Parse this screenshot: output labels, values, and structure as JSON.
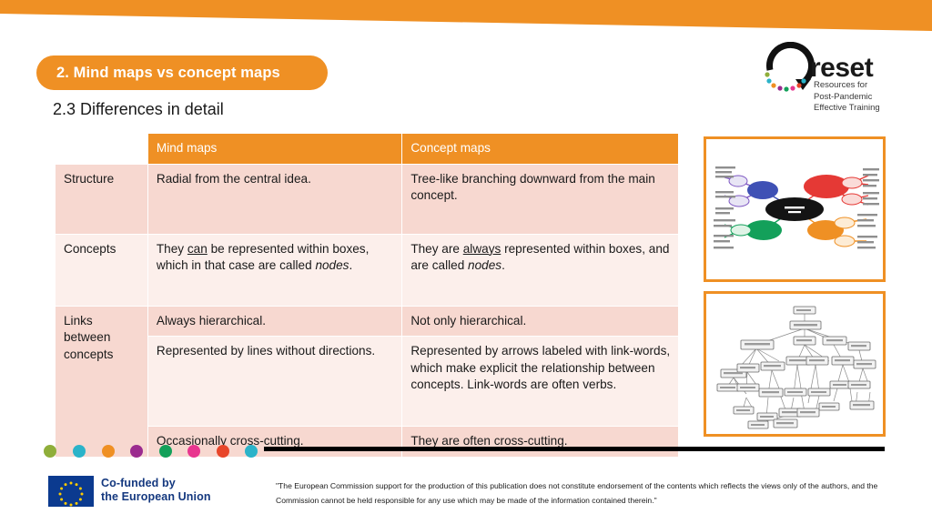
{
  "slide": {
    "section_title": "2. Mind maps vs concept maps",
    "subtitle": "2.3 Differences in detail"
  },
  "logo": {
    "wordmark": "reset",
    "tagline_line1": "Resources for",
    "tagline_line2": "Post-Pandemic",
    "tagline_line3": "Effective Training",
    "mark_name": "circular-arrow-with-dots",
    "dot_colors": [
      "#8fae3a",
      "#2bb3c9",
      "#ef9024",
      "#9b2b8f",
      "#13a05a",
      "#e8368f",
      "#e8462a",
      "#2bb3c9",
      "#8fae3a"
    ]
  },
  "table": {
    "headers": {
      "label": "",
      "mind_maps": "Mind maps",
      "concept_maps": "Concept maps"
    },
    "rows": [
      {
        "label": "Structure",
        "mind_maps": "Radial from the central idea.",
        "concept_maps": "Tree-like branching downward from the main concept."
      },
      {
        "label": "Concepts",
        "mind_maps_parts": {
          "before": "They ",
          "underline": "can",
          "middle": " be represented within boxes, which in that case are called ",
          "italic": "nodes",
          "after": "."
        },
        "concept_maps_parts": {
          "before": "They are ",
          "underline": "always",
          "middle": " represented within boxes, and are called ",
          "italic": "nodes",
          "after": "."
        }
      },
      {
        "label": "Links between concepts",
        "mind_maps_1": "Always hierarchical.",
        "concept_maps_1": "Not only hierarchical.",
        "mind_maps_2": "Represented by lines without directions.",
        "concept_maps_2": "Represented by arrows labeled with link-words, which make explicit the relationship between concepts. Link-words are often verbs.",
        "mind_maps_3": "Occasionally cross-cutting.",
        "concept_maps_3": "They are often cross-cutting."
      }
    ]
  },
  "images": {
    "mind_map_example": "mind-map-example",
    "concept_map_example": "concept-map-example"
  },
  "footer": {
    "dot_colors": [
      "#8fae3a",
      "#2bb3c9",
      "#ef9024",
      "#9b2b8f",
      "#13a05a",
      "#e8368f",
      "#e8462a",
      "#2bb3c9"
    ],
    "eu_text_line1": "Co-funded by",
    "eu_text_line2": "the European Union",
    "disclaimer": "\"The European Commission support for the production of this publication does not constitute endorsement of the contents which reflects the views only of the authors, and the Commission cannot be held responsible for any use which may be made of the information contained  therein.\""
  },
  "colors": {
    "orange": "#ef9024",
    "row_dark": "#f7d8d0",
    "row_light": "#fcefeb",
    "eu_blue": "#14387f"
  }
}
